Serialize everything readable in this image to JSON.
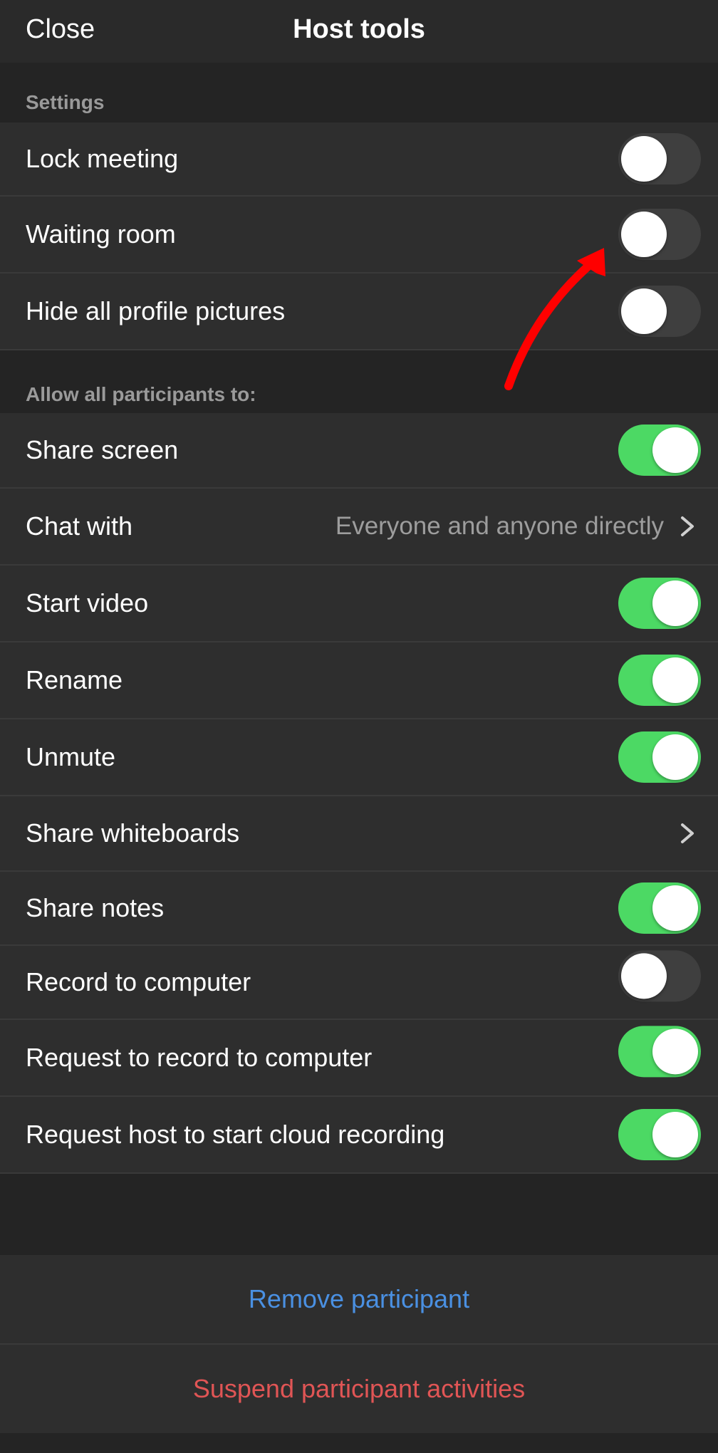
{
  "header": {
    "close_label": "Close",
    "title": "Host tools"
  },
  "settings": {
    "section_label": "Settings",
    "lock_meeting": {
      "label": "Lock meeting",
      "on": false
    },
    "waiting_room": {
      "label": "Waiting room",
      "on": false
    },
    "hide_profile_pictures": {
      "label": "Hide all profile pictures",
      "on": false
    }
  },
  "participants": {
    "section_label": "Allow all participants to:",
    "share_screen": {
      "label": "Share screen",
      "on": true
    },
    "chat_with": {
      "label": "Chat with",
      "value": "Everyone and anyone directly"
    },
    "start_video": {
      "label": "Start video",
      "on": true
    },
    "rename": {
      "label": "Rename",
      "on": true
    },
    "unmute": {
      "label": "Unmute",
      "on": true
    },
    "share_whiteboards": {
      "label": "Share whiteboards"
    },
    "share_notes": {
      "label": "Share notes",
      "on": true
    },
    "record_to_computer": {
      "label": "Record to computer",
      "on": false
    },
    "request_record": {
      "label": "Request to record to computer",
      "on": true
    },
    "request_cloud": {
      "label": "Request host to start cloud recording",
      "on": true
    }
  },
  "actions": {
    "remove_participant": "Remove participant",
    "suspend_activities": "Suspend participant activities"
  },
  "colors": {
    "background": "#242424",
    "row": "#2e2e2e",
    "toggle_on": "#4cd964",
    "toggle_off": "#3f3f3f",
    "link_blue": "#4a90e2",
    "danger_red": "#e05555",
    "annotation_arrow": "#ff0000"
  },
  "icons": {
    "chevron": "chevron-right-icon",
    "annotation": "red-arrow-annotation"
  }
}
